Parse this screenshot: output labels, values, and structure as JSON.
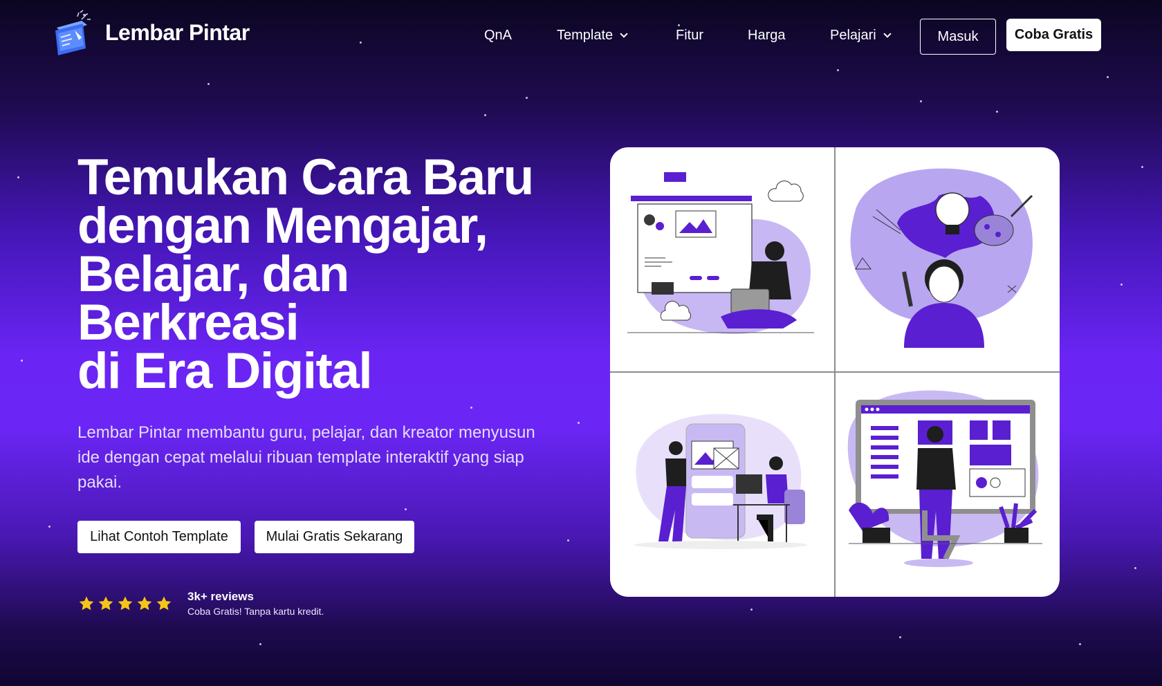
{
  "brand": {
    "name": "Lembar Pintar",
    "logo_icon": "book-rocket-icon"
  },
  "nav": {
    "items": [
      {
        "label": "QnA",
        "has_dropdown": false
      },
      {
        "label": "Template",
        "has_dropdown": true
      },
      {
        "label": "Fitur",
        "has_dropdown": false
      },
      {
        "label": "Harga",
        "has_dropdown": false
      },
      {
        "label": "Pelajari",
        "has_dropdown": true
      }
    ],
    "login_label": "Masuk",
    "signup_label": "Coba Gratis"
  },
  "hero": {
    "title_lines": [
      "Temukan Cara Baru",
      "dengan Mengajar,",
      "Belajar, dan",
      "Berkreasi",
      "di Era Digital"
    ],
    "description": "Lembar Pintar membantu guru, pelajar, dan kreator menyusun ide dengan cepat melalui ribuan template interaktif yang siap pakai.",
    "cta_primary": "Lihat Contoh Template",
    "cta_secondary": "Mulai Gratis Sekarang"
  },
  "rating": {
    "stars": 5,
    "count_text": "3k+ reviews",
    "subtext": "Coba Gratis! Tanpa kartu kredit."
  },
  "illustrations": [
    {
      "name": "web-design-illustration"
    },
    {
      "name": "creative-idea-illustration"
    },
    {
      "name": "app-design-team-illustration"
    },
    {
      "name": "dashboard-presentation-illustration"
    }
  ],
  "colors": {
    "accent": "#6a25f4",
    "accent_dark": "#3d0f9e",
    "illustration_purple": "#5a1fd0",
    "illustration_light": "#b9a6f0",
    "star": "#f5c518",
    "background_top": "#0c0621"
  }
}
